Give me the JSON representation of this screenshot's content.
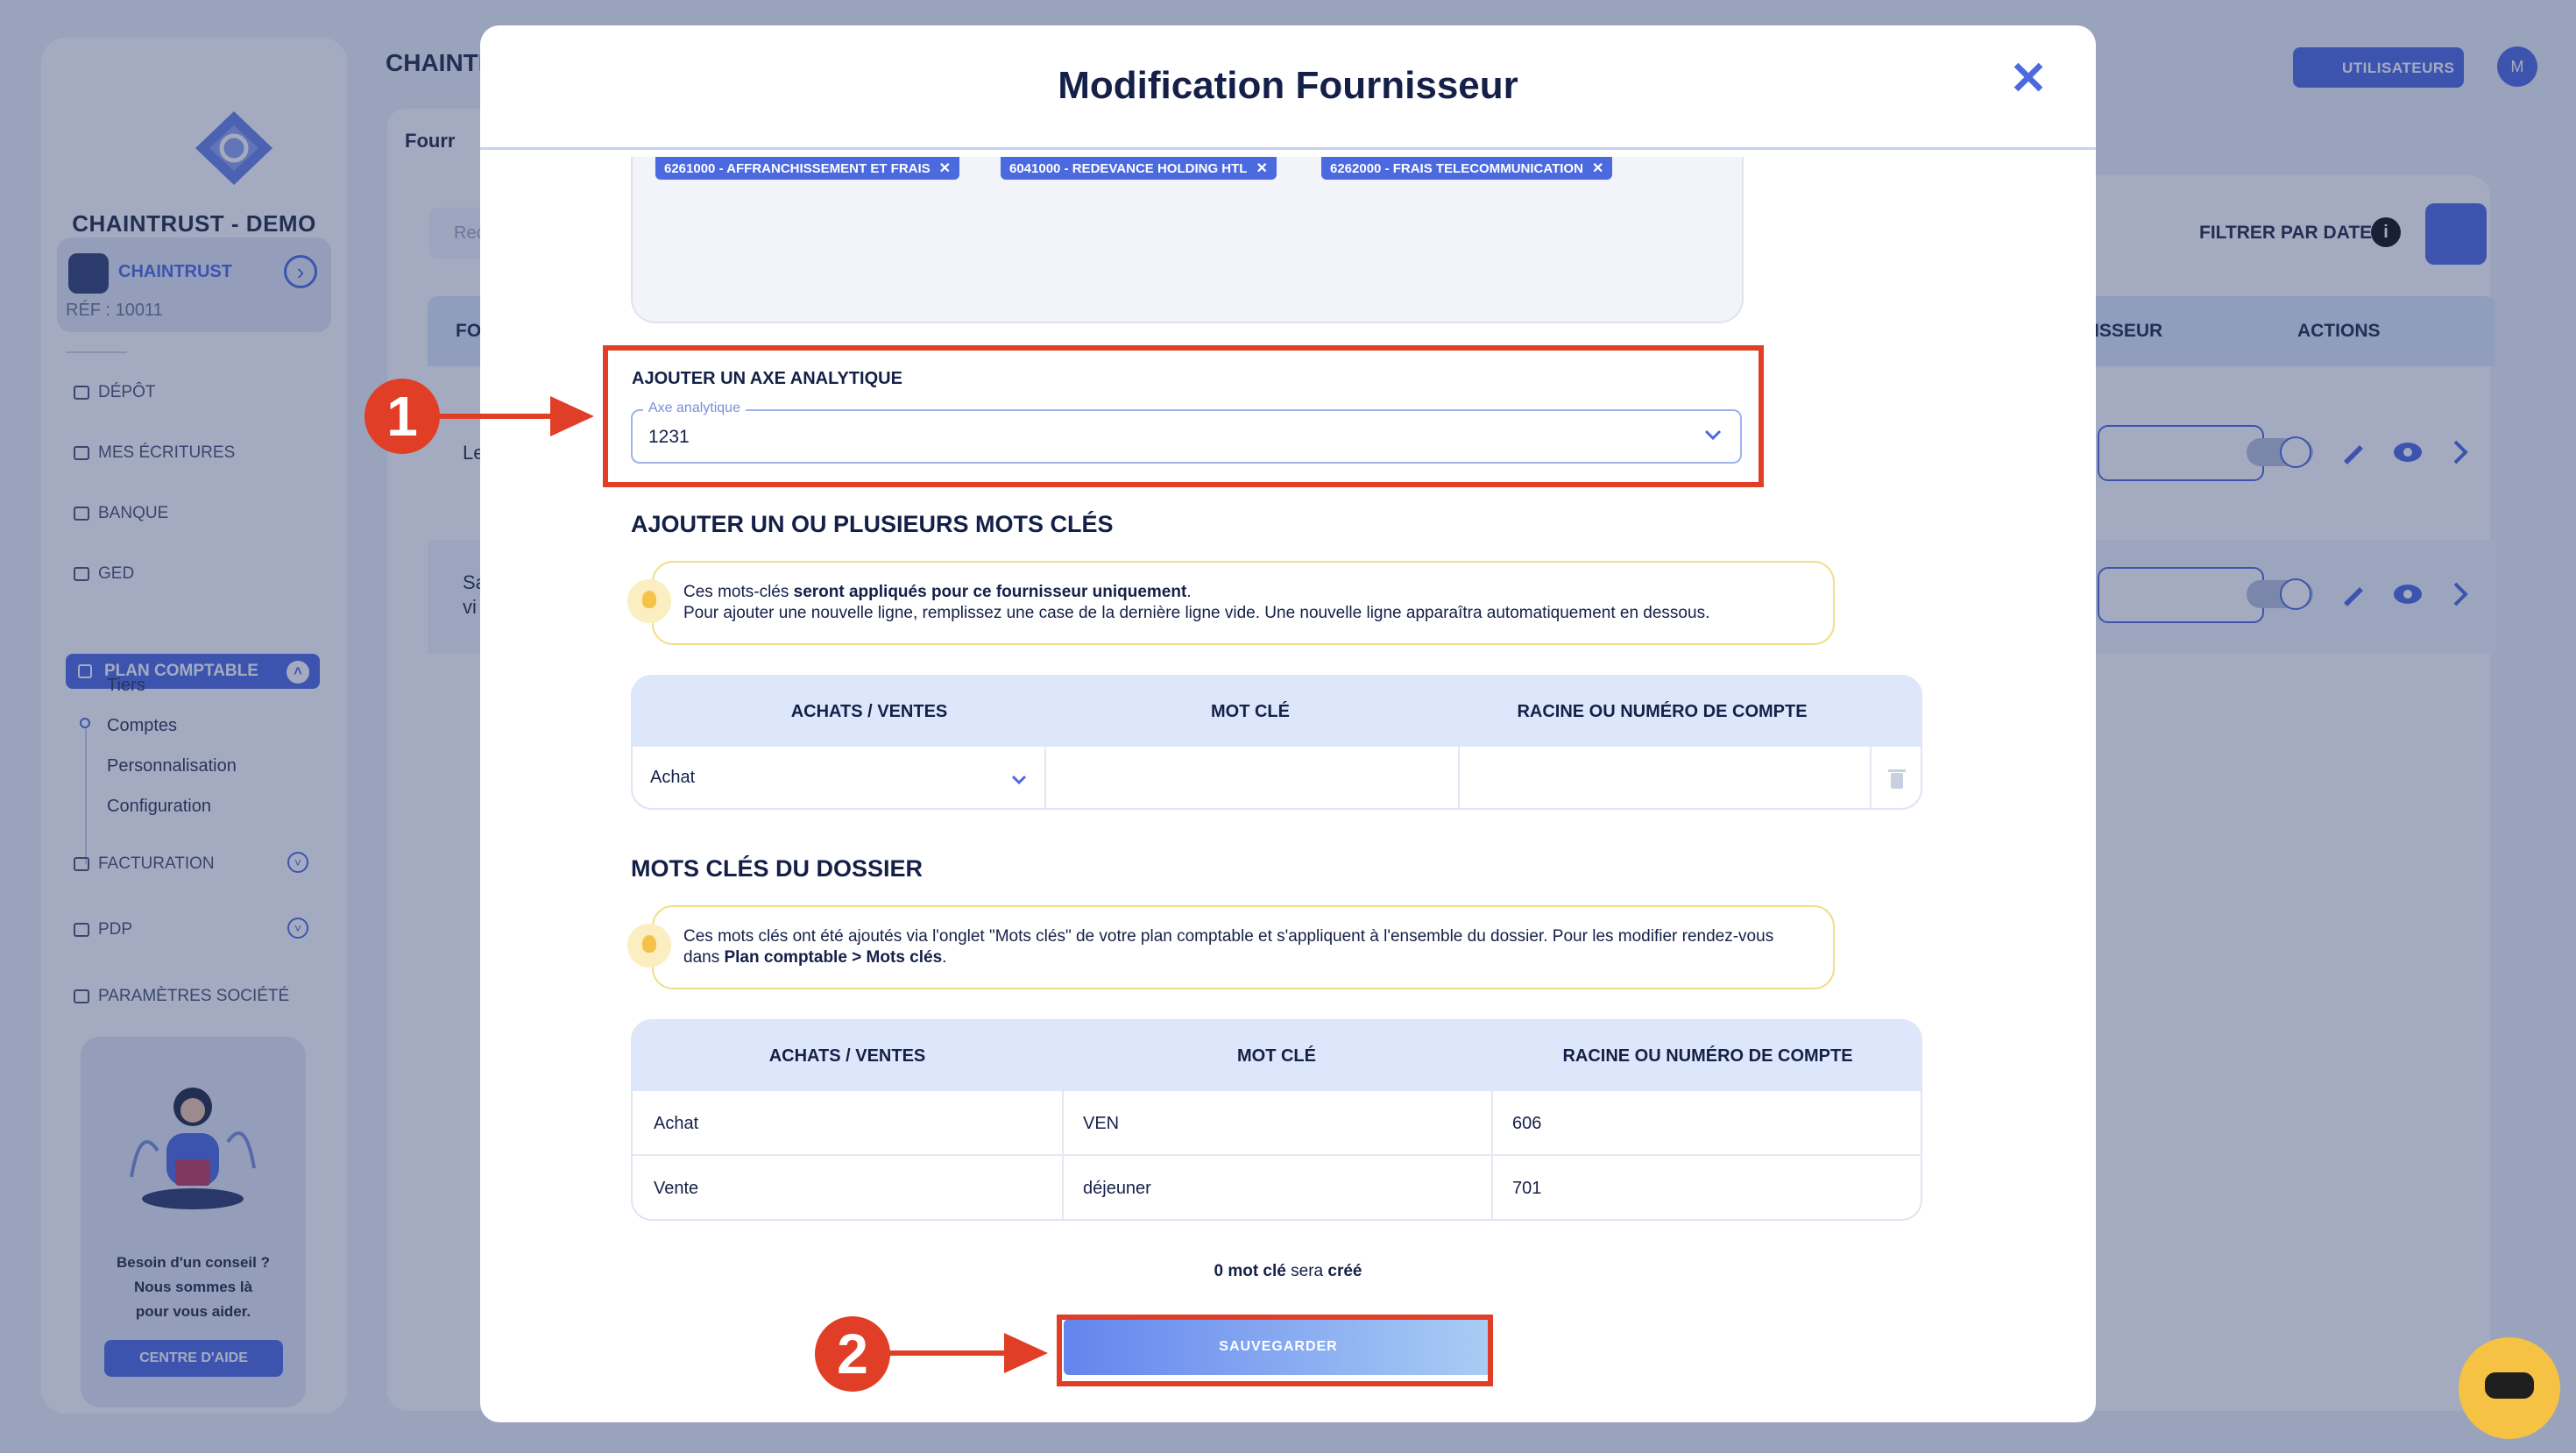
{
  "background": {
    "company": "CHAINTRUST - DEMO",
    "brand_card": {
      "name": "CHAINTRUST",
      "ref": "RÉF : 10011"
    },
    "nav": [
      {
        "label": "DÉPÔT"
      },
      {
        "label": "MES ÉCRITURES"
      },
      {
        "label": "BANQUE"
      },
      {
        "label": "GED"
      }
    ],
    "nav_active": "PLAN COMPTABLE",
    "subnav": [
      "Tiers",
      "Comptes",
      "Personnalisation",
      "Configuration"
    ],
    "nav_more": [
      {
        "label": "FACTURATION"
      },
      {
        "label": "PDP"
      },
      {
        "label": "PARAMÈTRES SOCIÉTÉ"
      }
    ],
    "help": {
      "line1": "Besoin d'un conseil ?",
      "line2": "Nous sommes là",
      "line3": "pour vous aider.",
      "button": "CENTRE D'AIDE"
    },
    "main_title": "CHAINTI",
    "tab_label": "Fourr",
    "search_placeholder": "Rec",
    "users_button": "UTILISATEURS",
    "avatar": "M",
    "filter_label": "FILTRER PAR DATE",
    "table_headers": {
      "first": "FO",
      "fournisseur": "ISSEUR",
      "actions": "ACTIONS"
    },
    "rows": [
      {
        "text": "Le"
      },
      {
        "text": "Sa",
        "text2": "vi"
      }
    ]
  },
  "modal": {
    "title": "Modification Fournisseur",
    "tags": [
      "6261000 - AFFRANCHISSEMENT ET FRAIS",
      "6041000 - REDEVANCE HOLDING HTL",
      "6262000 - FRAIS TELECOMMUNICATION"
    ],
    "axe": {
      "title": "AJOUTER UN AXE ANALYTIQUE",
      "legend": "Axe analytique",
      "value": "1231"
    },
    "keywords": {
      "title": "AJOUTER UN OU PLUSIEURS MOTS CLÉS",
      "info_pre": "Ces mots-clés ",
      "info_bold": "seront appliqués pour ce fournisseur uniquement",
      "info_post": ".",
      "info_line2": "Pour ajouter une nouvelle ligne, remplissez une case de la dernière ligne vide. Une nouvelle ligne apparaîtra automatiquement en dessous.",
      "headers": [
        "ACHATS / VENTES",
        "MOT CLÉ",
        "RACINE OU NUMÉRO DE COMPTE"
      ],
      "row_type": "Achat"
    },
    "dossier": {
      "title": "MOTS CLÉS DU DOSSIER",
      "info_line1": "Ces mots clés ont été ajoutés via l'onglet \"Mots clés\" de votre plan comptable et s'appliquent à l'ensemble du dossier. Pour les modifier rendez-vous",
      "info_pre2": "dans ",
      "info_bold2": "Plan comptable > Mots clés",
      "info_post2": ".",
      "headers": [
        "ACHATS / VENTES",
        "MOT CLÉ",
        "RACINE OU NUMÉRO DE COMPTE"
      ],
      "rows": [
        {
          "type": "Achat",
          "keyword": "VEN",
          "account": "606"
        },
        {
          "type": "Vente",
          "keyword": "déjeuner",
          "account": "701"
        }
      ]
    },
    "counter": {
      "count": "0 mot clé",
      "middle": " sera ",
      "end": "créé"
    },
    "save_label": "SAUVEGARDER"
  },
  "annotations": {
    "badge1": "1",
    "badge2": "2"
  },
  "colors": {
    "accent": "#4c6ae0",
    "annotation": "#e03e26",
    "overlay": "#263868"
  }
}
